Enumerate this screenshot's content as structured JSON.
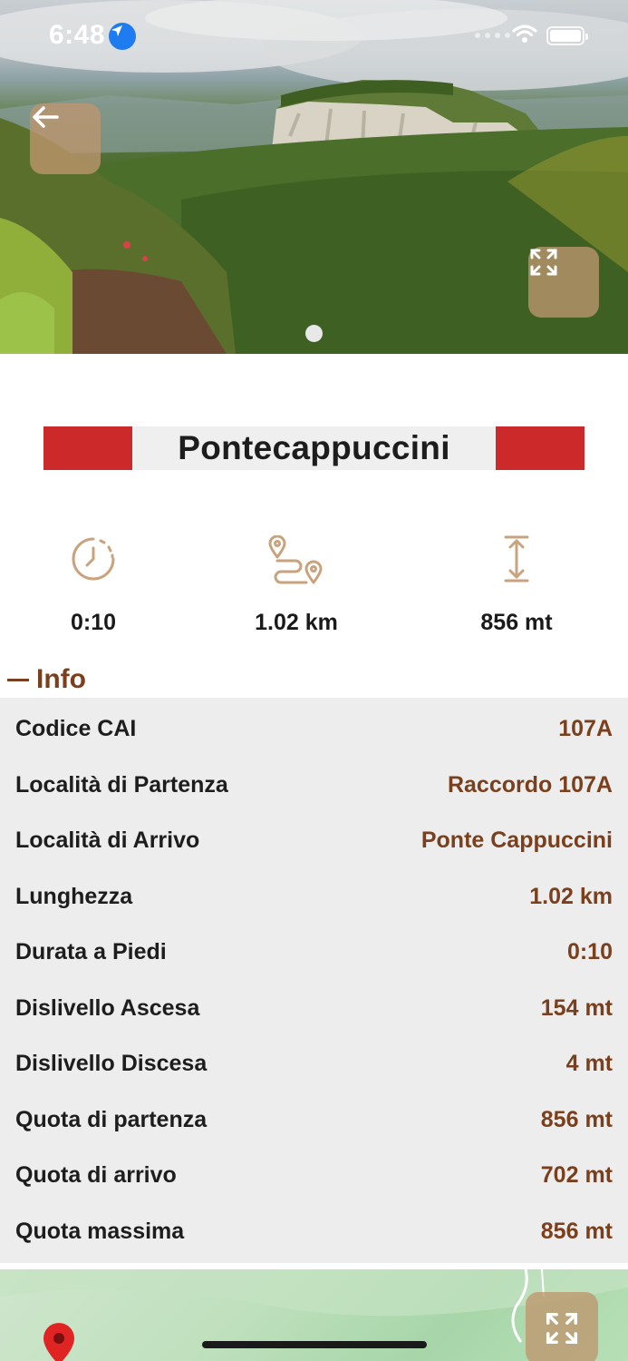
{
  "status_bar": {
    "time": "6:48"
  },
  "trail": {
    "name": "Pontecappuccini"
  },
  "stats": {
    "duration": "0:10",
    "length": "1.02 km",
    "altitude": "856 mt"
  },
  "info": {
    "heading": "Info",
    "rows": [
      {
        "label": "Codice CAI",
        "value": "107A"
      },
      {
        "label": "Località di Partenza",
        "value": "Raccordo 107A"
      },
      {
        "label": "Località di Arrivo",
        "value": "Ponte Cappuccini"
      },
      {
        "label": "Lunghezza",
        "value": "1.02 km"
      },
      {
        "label": "Durata a Piedi",
        "value": "0:10"
      },
      {
        "label": "Dislivello Ascesa",
        "value": "154 mt"
      },
      {
        "label": "Dislivello Discesa",
        "value": "4 mt"
      },
      {
        "label": "Quota di partenza",
        "value": "856 mt"
      },
      {
        "label": "Quota di arrivo",
        "value": "702 mt"
      },
      {
        "label": "Quota massima",
        "value": "856 mt"
      }
    ]
  },
  "colors": {
    "accent_brown": "#7a3f1d",
    "trail_red": "#cc2a2a",
    "icon_tan": "#c9a27e"
  },
  "icons": {
    "back": "arrow-left-icon",
    "expand": "expand-icon",
    "duration": "clock-icon",
    "length": "route-icon",
    "altitude": "vertical-arrows-icon",
    "map_pin": "map-pin-icon"
  }
}
